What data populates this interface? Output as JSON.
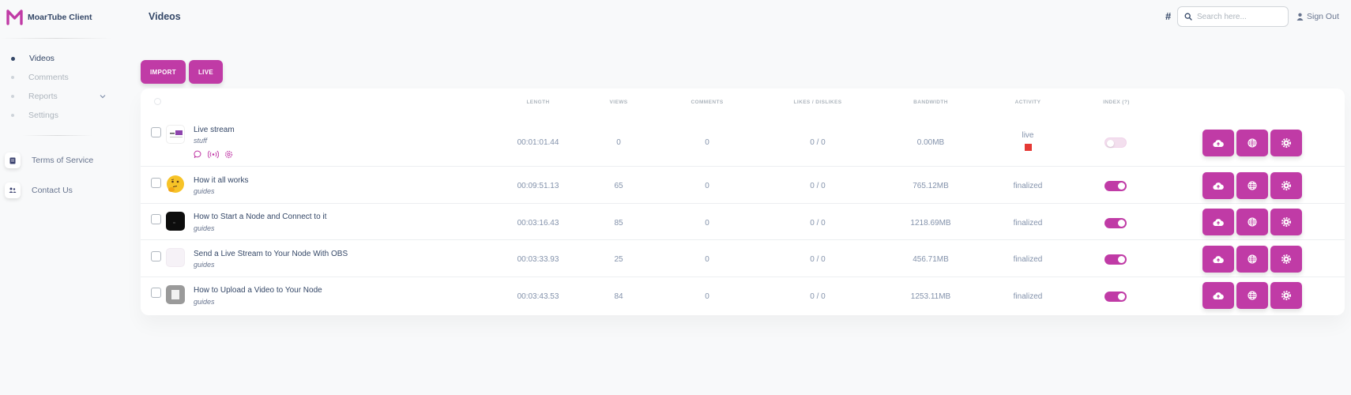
{
  "app": {
    "name": "MoarTube Client",
    "page_title": "Videos"
  },
  "sidebar": {
    "nav": [
      {
        "label": "Videos",
        "active": true
      },
      {
        "label": "Comments",
        "active": false
      },
      {
        "label": "Reports",
        "active": false
      },
      {
        "label": "Settings",
        "active": false
      }
    ],
    "links": [
      {
        "label": "Terms of Service",
        "icon": "document-icon"
      },
      {
        "label": "Contact Us",
        "icon": "users-icon"
      }
    ]
  },
  "header": {
    "hash_symbol": "#",
    "search_placeholder": "Search here...",
    "signout_label": "Sign Out"
  },
  "toolbar": {
    "import_label": "IMPORT",
    "live_label": "LIVE"
  },
  "colors": {
    "accent": "#c03ba6",
    "live_indicator": "#e53935",
    "text": "#344767",
    "muted": "#8392ab"
  },
  "table": {
    "headers": {
      "length": "LENGTH",
      "views": "VIEWS",
      "comments": "COMMENTS",
      "likes": "LIKES / DISLIKES",
      "bandwidth": "BANDWIDTH",
      "activity": "ACTIVITY",
      "index": "INDEX (?)"
    },
    "rows": [
      {
        "title": "Live stream",
        "category": "stuff",
        "length": "00:01:01.44",
        "views": "0",
        "comments": "0",
        "likes": "0 / 0",
        "bandwidth": "0.00MB",
        "activity": "live",
        "indexed": false
      },
      {
        "title": "How it all works",
        "category": "guides",
        "length": "00:09:51.13",
        "views": "65",
        "comments": "0",
        "likes": "0 / 0",
        "bandwidth": "765.12MB",
        "activity": "finalized",
        "indexed": true
      },
      {
        "title": "How to Start a Node and Connect to it",
        "category": "guides",
        "length": "00:03:16.43",
        "views": "85",
        "comments": "0",
        "likes": "0 / 0",
        "bandwidth": "1218.69MB",
        "activity": "finalized",
        "indexed": true
      },
      {
        "title": "Send a Live Stream to Your Node With OBS",
        "category": "guides",
        "length": "00:03:33.93",
        "views": "25",
        "comments": "0",
        "likes": "0 / 0",
        "bandwidth": "456.71MB",
        "activity": "finalized",
        "indexed": true
      },
      {
        "title": "How to Upload a Video to Your Node",
        "category": "guides",
        "length": "00:03:43.53",
        "views": "84",
        "comments": "0",
        "likes": "0 / 0",
        "bandwidth": "1253.11MB",
        "activity": "finalized",
        "indexed": true
      }
    ]
  }
}
